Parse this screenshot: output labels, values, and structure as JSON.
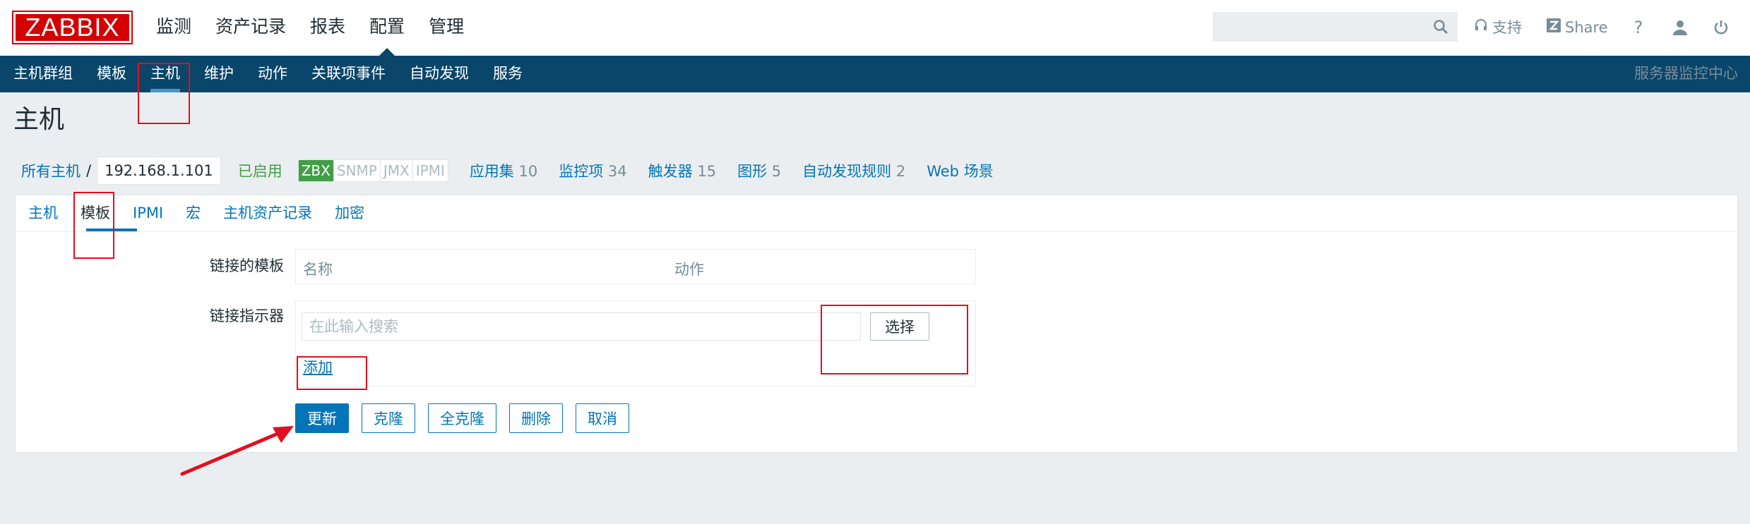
{
  "app": {
    "logo": "ZABBIX",
    "server_name": "服务器监控中心"
  },
  "main_menu": [
    {
      "label": "监测",
      "active": false
    },
    {
      "label": "资产记录",
      "active": false
    },
    {
      "label": "报表",
      "active": false
    },
    {
      "label": "配置",
      "active": true
    },
    {
      "label": "管理",
      "active": false
    }
  ],
  "topbar": {
    "search_placeholder": "",
    "support_label": "支持",
    "share_label": "Share",
    "help_glyph": "?"
  },
  "sub_menu": [
    {
      "label": "主机群组",
      "active": false
    },
    {
      "label": "模板",
      "active": false
    },
    {
      "label": "主机",
      "active": true
    },
    {
      "label": "维护",
      "active": false
    },
    {
      "label": "动作",
      "active": false
    },
    {
      "label": "关联项事件",
      "active": false
    },
    {
      "label": "自动发现",
      "active": false
    },
    {
      "label": "服务",
      "active": false
    }
  ],
  "page": {
    "title": "主机"
  },
  "host_info": {
    "all_hosts": "所有主机",
    "separator": "/",
    "host": "192.168.1.101",
    "status": "已启用",
    "availability": [
      {
        "label": "ZBX",
        "on": true
      },
      {
        "label": "SNMP",
        "on": false
      },
      {
        "label": "JMX",
        "on": false
      },
      {
        "label": "IPMI",
        "on": false
      }
    ],
    "links": [
      {
        "label": "应用集",
        "count": "10"
      },
      {
        "label": "监控项",
        "count": "34"
      },
      {
        "label": "触发器",
        "count": "15"
      },
      {
        "label": "图形",
        "count": "5"
      },
      {
        "label": "自动发现规则",
        "count": "2"
      },
      {
        "label": "Web 场景",
        "count": ""
      }
    ]
  },
  "tabs": [
    {
      "label": "主机",
      "active": false
    },
    {
      "label": "模板",
      "active": true
    },
    {
      "label": "IPMI",
      "active": false
    },
    {
      "label": "宏",
      "active": false
    },
    {
      "label": "主机资产记录",
      "active": false
    },
    {
      "label": "加密",
      "active": false
    }
  ],
  "form": {
    "linked_templates_label": "链接的模板",
    "col_name": "名称",
    "col_action": "动作",
    "link_indicator_label": "链接指示器",
    "search_placeholder": "在此输入搜索",
    "select_button": "选择",
    "add_link": "添加"
  },
  "buttons": {
    "update": "更新",
    "clone": "克隆",
    "full_clone": "全克隆",
    "delete": "删除",
    "cancel": "取消"
  },
  "colors": {
    "nav_bg": "#0a466a",
    "accent": "#0275b8",
    "enabled_green": "#429e47",
    "annotation_red": "#e01020",
    "logo_red": "#d40000"
  }
}
